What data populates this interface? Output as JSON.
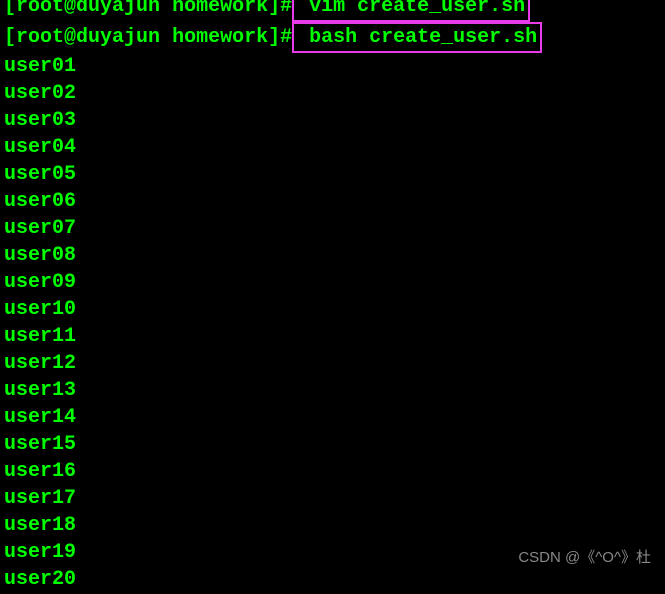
{
  "prompt1": {
    "bracket_open": "[",
    "user_host": "root@duyajun",
    "space": " ",
    "dir": "homework",
    "bracket_close": "]#",
    "command_partial": " vim create_user.sn"
  },
  "prompt2": {
    "bracket_open": "[",
    "user_host": "root@duyajun",
    "space": " ",
    "dir": "homework",
    "bracket_close": "]#",
    "command": " bash create_user.sh"
  },
  "output": [
    "user01",
    "user02",
    "user03",
    "user04",
    "user05",
    "user06",
    "user07",
    "user08",
    "user09",
    "user10",
    "user11",
    "user12",
    "user13",
    "user14",
    "user15",
    "user16",
    "user17",
    "user18",
    "user19",
    "user20"
  ],
  "watermark": "CSDN @《^O^》杜"
}
